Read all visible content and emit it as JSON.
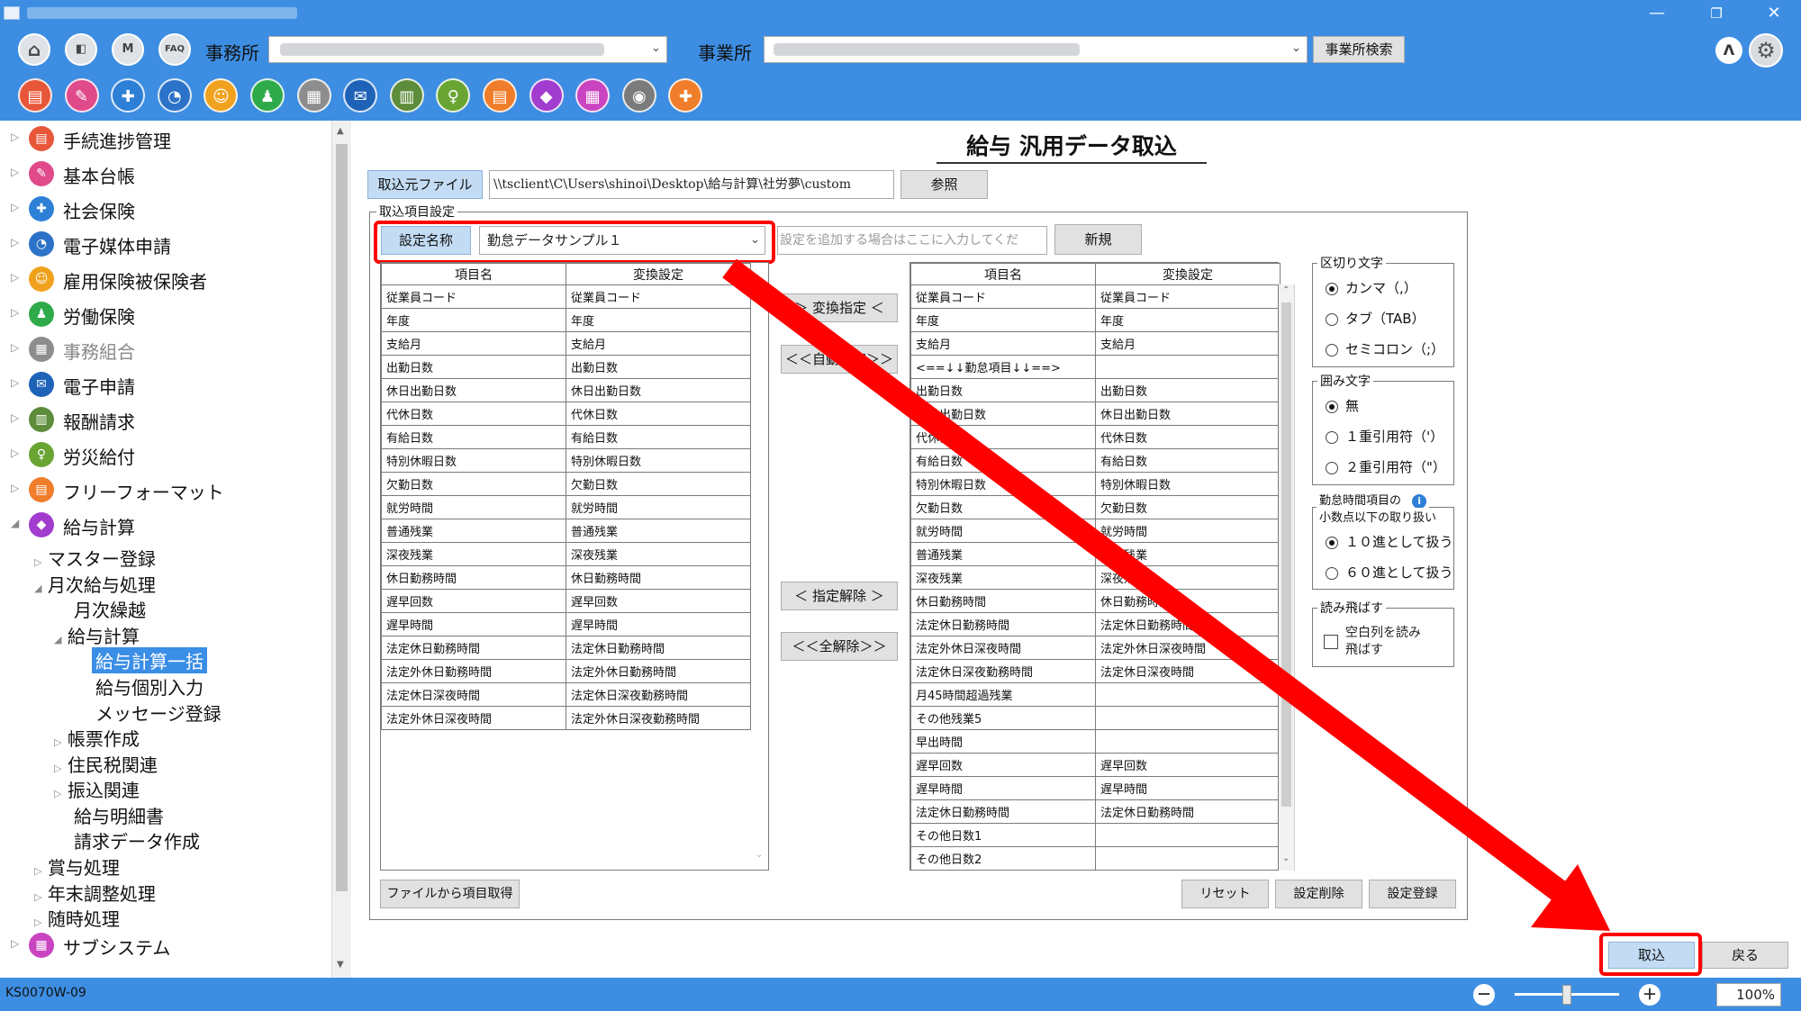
{
  "window": {
    "minimize": "—",
    "restore": "❐",
    "close": "✕"
  },
  "toolbar": {
    "btn_home": "⌂",
    "btn_back": "◧",
    "btn_m": "M",
    "btn_faq": "FAQ",
    "office_label": "事務所",
    "site_label": "事業所",
    "site_search": "事業所検索",
    "collapse": "Λ",
    "apps": [
      {
        "color": "#e8573a",
        "glyph": "▤"
      },
      {
        "color": "#e04a8a",
        "glyph": "✎"
      },
      {
        "color": "#2e7fd6",
        "glyph": "✚"
      },
      {
        "color": "#2b72c8",
        "glyph": "◔"
      },
      {
        "color": "#f0a21e",
        "glyph": "☺"
      },
      {
        "color": "#2faa4a",
        "glyph": "♟"
      },
      {
        "color": "#8d8d8d",
        "glyph": "▦"
      },
      {
        "color": "#1f63b8",
        "glyph": "✉"
      },
      {
        "color": "#5d8c3a",
        "glyph": "▥"
      },
      {
        "color": "#6aa533",
        "glyph": "♀"
      },
      {
        "color": "#f07d2a",
        "glyph": "▤"
      },
      {
        "color": "#a23ccf",
        "glyph": "◆"
      },
      {
        "color": "#c944c0",
        "glyph": "▦"
      },
      {
        "color": "#7b7b7b",
        "glyph": "◉"
      },
      {
        "color": "#f07d2a",
        "glyph": "✚"
      }
    ]
  },
  "sidebar": {
    "items": [
      {
        "label": "手続進捗管理",
        "color": "#e8573a",
        "glyph": "▤"
      },
      {
        "label": "基本台帳",
        "color": "#e04a8a",
        "glyph": "✎"
      },
      {
        "label": "社会保険",
        "color": "#2e7fd6",
        "glyph": "✚"
      },
      {
        "label": "電子媒体申請",
        "color": "#2b72c8",
        "glyph": "◔"
      },
      {
        "label": "雇用保険被保険者",
        "color": "#f0a21e",
        "glyph": "☺"
      },
      {
        "label": "労働保険",
        "color": "#2faa4a",
        "glyph": "♟"
      },
      {
        "label": "事務組合",
        "color": "#8d8d8d",
        "glyph": "▦"
      },
      {
        "label": "電子申請",
        "color": "#1f63b8",
        "glyph": "✉"
      },
      {
        "label": "報酬請求",
        "color": "#5d8c3a",
        "glyph": "▥"
      },
      {
        "label": "労災給付",
        "color": "#6aa533",
        "glyph": "♀"
      },
      {
        "label": "フリーフォーマット",
        "color": "#f07d2a",
        "glyph": "▤"
      },
      {
        "label": "給与計算",
        "color": "#a23ccf",
        "glyph": "◆"
      }
    ],
    "sub": {
      "master": "マスター登録",
      "monthly": "月次給与処理",
      "carryover": "月次繰越",
      "calc": "給与計算",
      "calc_bulk": "給与計算一括",
      "calc_individual": "給与個別入力",
      "message": "メッセージ登録",
      "forms": "帳票作成",
      "resident_tax": "住民税関連",
      "transfer": "振込関連",
      "payslip": "給与明細書",
      "billing": "請求データ作成",
      "bonus": "賞与処理",
      "year_end": "年末調整処理",
      "ad_hoc": "随時処理",
      "subsystem": "サブシステム"
    },
    "subsystem_color": "#c944c0"
  },
  "page": {
    "title": "給与 汎用データ取込",
    "source_btn": "取込元ファイル",
    "source_path": "\\\\tsclient\\C\\Users\\shinoi\\Desktop\\給与計算\\社労夢\\custom",
    "browse": "参照",
    "group_caption": "取込項目設定",
    "setting_name_btn": "設定名称",
    "setting_name_value": "勤怠データサンプル１",
    "new_setting_placeholder": "設定を追加する場合はここに入力してくだ",
    "new_btn": "新規",
    "col_item": "項目名",
    "col_conv": "変換設定",
    "left_rows": [
      [
        "従業員コード",
        "従業員コード"
      ],
      [
        "年度",
        "年度"
      ],
      [
        "支給月",
        "支給月"
      ],
      [
        "出勤日数",
        "出勤日数"
      ],
      [
        "休日出勤日数",
        "休日出勤日数"
      ],
      [
        "代休日数",
        "代休日数"
      ],
      [
        "有給日数",
        "有給日数"
      ],
      [
        "特別休暇日数",
        "特別休暇日数"
      ],
      [
        "欠勤日数",
        "欠勤日数"
      ],
      [
        "就労時間",
        "就労時間"
      ],
      [
        "普通残業",
        "普通残業"
      ],
      [
        "深夜残業",
        "深夜残業"
      ],
      [
        "休日勤務時間",
        "休日勤務時間"
      ],
      [
        "遅早回数",
        "遅早回数"
      ],
      [
        "遅早時間",
        "遅早時間"
      ],
      [
        "法定休日勤務時間",
        "法定休日勤務時間"
      ],
      [
        "法定外休日勤務時間",
        "法定外休日勤務時間"
      ],
      [
        "法定休日深夜時間",
        "法定休日深夜勤務時間"
      ],
      [
        "法定外休日深夜時間",
        "法定外休日深夜勤務時間"
      ]
    ],
    "right_rows": [
      [
        "従業員コード",
        "従業員コード"
      ],
      [
        "年度",
        "年度"
      ],
      [
        "支給月",
        "支給月"
      ],
      [
        "<==↓↓勤怠項目↓↓==>",
        ""
      ],
      [
        "出勤日数",
        "出勤日数"
      ],
      [
        "休日出勤日数",
        "休日出勤日数"
      ],
      [
        "代休日数",
        "代休日数"
      ],
      [
        "有給日数",
        "有給日数"
      ],
      [
        "特別休暇日数",
        "特別休暇日数"
      ],
      [
        "欠勤日数",
        "欠勤日数"
      ],
      [
        "就労時間",
        "就労時間"
      ],
      [
        "普通残業",
        "普通残業"
      ],
      [
        "深夜残業",
        "深夜残業"
      ],
      [
        "休日勤務時間",
        "休日勤務時間"
      ],
      [
        "法定休日勤務時間",
        "法定休日勤務時間"
      ],
      [
        "法定外休日深夜時間",
        "法定外休日深夜時間"
      ],
      [
        "法定休日深夜勤務時間",
        "法定休日深夜時間"
      ],
      [
        "月45時間超過残業",
        ""
      ],
      [
        "その他残業5",
        ""
      ],
      [
        "早出時間",
        ""
      ],
      [
        "遅早回数",
        "遅早回数"
      ],
      [
        "遅早時間",
        "遅早時間"
      ],
      [
        "法定休日勤務時間",
        "法定休日勤務時間"
      ],
      [
        "その他日数1",
        ""
      ],
      [
        "その他日数2",
        ""
      ]
    ],
    "btn_assign": "＞ 変換指定 ＜",
    "btn_auto": "＜＜自動指定＞＞",
    "btn_unassign": "＜ 指定解除 ＞",
    "btn_unassign_all": "＜＜全解除＞＞",
    "btn_get_from_file": "ファイルから項目取得",
    "btn_reset": "リセット",
    "btn_delete_setting": "設定削除",
    "btn_register_setting": "設定登録",
    "delim_caption": "区切り文字",
    "delim_options": [
      "カンマ（,）",
      "タブ（TAB）",
      "セミコロン（;）"
    ],
    "quote_caption": "囲み文字",
    "quote_options": [
      "無",
      "１重引用符（'）",
      "２重引用符（\"）"
    ],
    "time_caption_1": "勤怠時間項目の",
    "time_caption_2": "小数点以下の取り扱い",
    "time_options": [
      "１０進として扱う",
      "６０進として扱う"
    ],
    "skip_caption": "読み飛ばす",
    "skip_label_1": "空白列を読み",
    "skip_label_2": "飛ばす",
    "import_btn": "取込",
    "return_btn": "戻る"
  },
  "status": {
    "screen_id": "KS0070W-09",
    "zoom_out": "－",
    "zoom_in": "＋",
    "zoom_value": "100%",
    "zoom_fraction": 0.5
  },
  "colors": {
    "accent_blue": "#3d8ee2",
    "highlight_red": "#ff0000",
    "selected_nav": "#3a8ee6"
  }
}
